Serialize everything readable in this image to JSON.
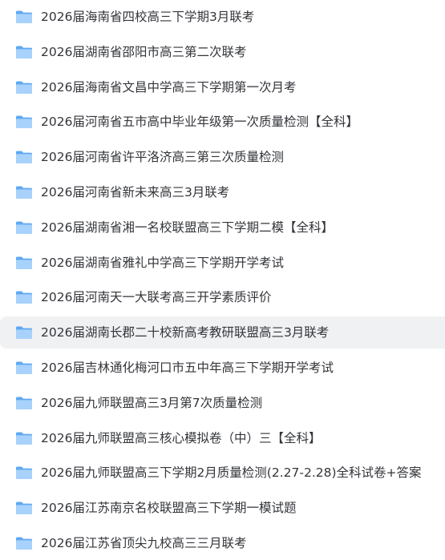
{
  "folders": [
    {
      "name": "2026届海南省四校高三下学期3月联考"
    },
    {
      "name": "2026届湖南省邵阳市高三第二次联考"
    },
    {
      "name": "2026届海南省文昌中学高三下学期第一次月考"
    },
    {
      "name": "2026届河南省五市高中毕业年级第一次质量检测【全科】"
    },
    {
      "name": "2026届河南省许平洛济高三第三次质量检测"
    },
    {
      "name": "2026届河南省新未来高三3月联考"
    },
    {
      "name": "2026届湖南省湘一名校联盟高三下学期二模【全科】"
    },
    {
      "name": "2026届湖南省雅礼中学高三下学期开学考试"
    },
    {
      "name": "2026届河南天一大联考高三开学素质评价"
    },
    {
      "name": "2026届湖南长郡二十校新高考教研联盟高三3月联考"
    },
    {
      "name": "2026届吉林通化梅河口市五中年高三下学期开学考试"
    },
    {
      "name": "2026届九师联盟高三3月第7次质量检测"
    },
    {
      "name": "2026届九师联盟高三核心模拟卷（中）三【全科】"
    },
    {
      "name": "2026届九师联盟高三下学期2月质量检测(2.27-2.28)全科试卷+答案"
    },
    {
      "name": "2026届江苏南京名校联盟高三下学期一模试题"
    },
    {
      "name": "2026届江苏省顶尖九校高三三月联考"
    }
  ],
  "selected_index": 9,
  "colors": {
    "folder_back": "#5fa8f2",
    "folder_front": "#a8d2fb",
    "text": "#33353a",
    "selected_bg": "#f0f1f3"
  },
  "icon": "folder-icon"
}
